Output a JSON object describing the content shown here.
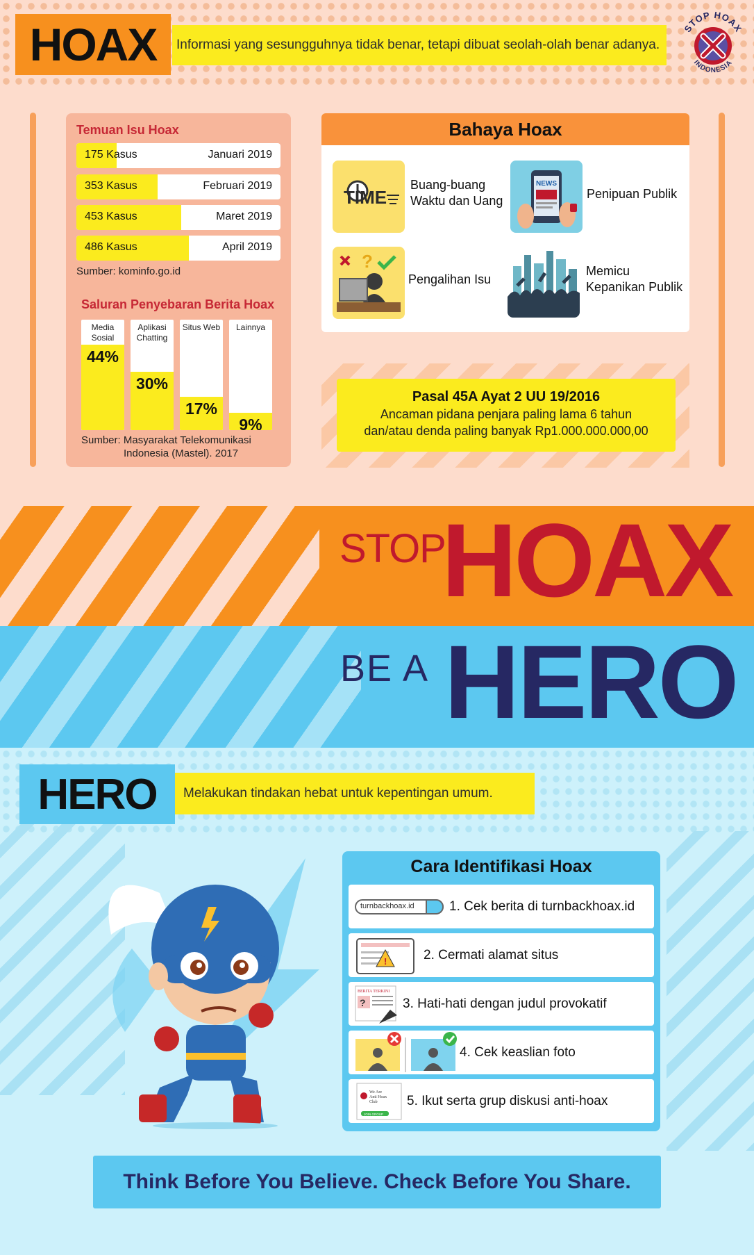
{
  "header": {
    "title": "HOAX",
    "definition": "Informasi yang sesungguhnya tidak benar, tetapi dibuat seolah-olah benar adanya.",
    "badge": {
      "top": "STOP HOAX",
      "bottom": "INDONESIA"
    }
  },
  "temuan": {
    "title": "Temuan Isu Hoax",
    "rows": [
      {
        "count": "175 Kasus",
        "month": "Januari 2019",
        "value": 175
      },
      {
        "count": "353 Kasus",
        "month": "Februari 2019",
        "value": 353
      },
      {
        "count": "453 Kasus",
        "month": "Maret 2019",
        "value": 453
      },
      {
        "count": "486 Kasus",
        "month": "April 2019",
        "value": 486
      }
    ],
    "source": "Sumber: kominfo.go.id"
  },
  "saluran": {
    "title": "Saluran Penyebaran Berita Hoax",
    "channels": [
      {
        "label_1": "Media",
        "label_2": "Sosial",
        "value_text": "44%",
        "value": 44
      },
      {
        "label_1": "Aplikasi",
        "label_2": "Chatting",
        "value_text": "30%",
        "value": 30
      },
      {
        "label_1": "Situs Web",
        "label_2": "",
        "value_text": "17%",
        "value": 17
      },
      {
        "label_1": "Lainnya",
        "label_2": "",
        "value_text": "9%",
        "value": 9
      }
    ],
    "source_line_1": "Sumber: Masyarakat Telekomunikasi",
    "source_line_2": "Indonesia (Mastel). 2017"
  },
  "bahaya": {
    "title": "Bahaya Hoax",
    "items": [
      {
        "line_1": "Buang-buang",
        "line_2": "Waktu dan Uang",
        "icon": "time-icon",
        "icon_text": "TIME"
      },
      {
        "line_1": "Penipuan Publik",
        "line_2": "",
        "icon": "news-phone-icon",
        "icon_text": "NEWS"
      },
      {
        "line_1": "Pengalihan Isu",
        "line_2": "",
        "icon": "confused-person-icon"
      },
      {
        "line_1": "Memicu",
        "line_2": "Kepanikan Publik",
        "icon": "crowd-panic-icon"
      }
    ]
  },
  "pasal": {
    "title": "Pasal 45A Ayat 2 UU 19/2016",
    "line_1": "Ancaman pidana penjara paling lama 6  tahun",
    "line_2": "dan/atau denda paling banyak Rp1.000.000.000,00"
  },
  "banner_stop": {
    "small": "STOP",
    "big": "HOAX"
  },
  "banner_hero": {
    "small": "BE A",
    "big": "HERO"
  },
  "hero_def": {
    "title": "HERO",
    "definition": "Melakukan tindakan hebat untuk kepentingan umum."
  },
  "cara": {
    "title": "Cara Identifikasi Hoax",
    "search_text": "turnbackhoax.id",
    "mini_headline": "BERITA TERKINI",
    "club_line_1": "We Are",
    "club_line_2": "Anti Hoax",
    "club_line_3": "Club",
    "club_button": "JOIN GROUP",
    "steps": [
      "1. Cek berita di turnbackhoax.id",
      "2. Cermati alamat situs",
      "3. Hati-hati dengan judul provokatif",
      "4. Cek keaslian foto",
      "5. Ikut serta grup diskusi anti-hoax"
    ]
  },
  "tagline": "Think Before You Believe. Check Before You Share.",
  "colors": {
    "orange": "#f7901e",
    "yellow": "#fbeb1e",
    "red": "#c0192d",
    "navy": "#262863",
    "sky": "#5cc8f0",
    "peach": "#fddccc"
  }
}
